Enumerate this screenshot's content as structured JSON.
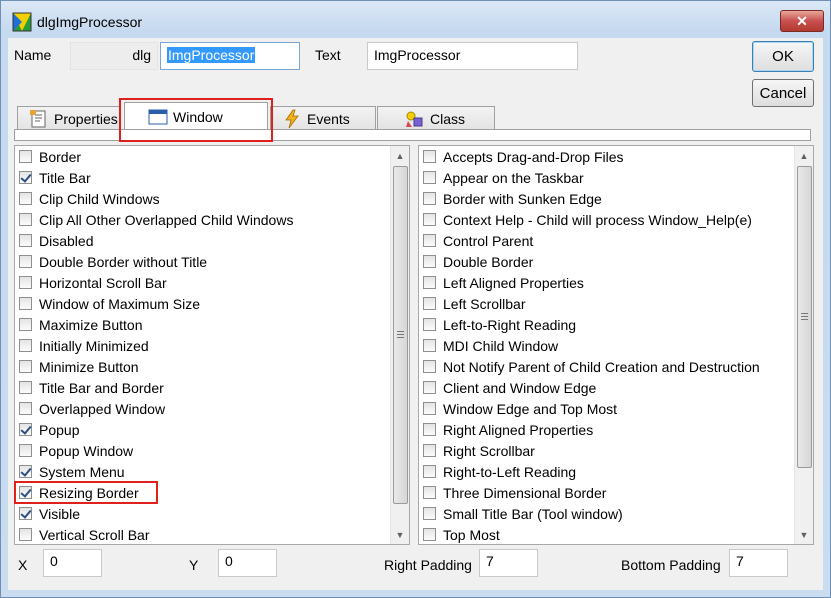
{
  "window": {
    "title": "dlgImgProcessor",
    "close_glyph": "✕"
  },
  "header": {
    "name_label": "Name",
    "name_prefix": "dlg",
    "name_value": "ImgProcessor",
    "text_label": "Text",
    "text_value": "ImgProcessor",
    "ok_label": "OK",
    "cancel_label": "Cancel"
  },
  "tabs": [
    {
      "label": "Properties",
      "icon": "properties-icon"
    },
    {
      "label": "Window",
      "icon": "window-icon",
      "active": true
    },
    {
      "label": "Events",
      "icon": "lightning-icon"
    },
    {
      "label": "Class",
      "icon": "class-icon"
    }
  ],
  "left_list": [
    {
      "label": "Border",
      "checked": false
    },
    {
      "label": "Title Bar",
      "checked": true
    },
    {
      "label": "Clip Child Windows",
      "checked": false
    },
    {
      "label": "Clip All Other Overlapped Child Windows",
      "checked": false
    },
    {
      "label": "Disabled",
      "checked": false
    },
    {
      "label": "Double Border without Title",
      "checked": false
    },
    {
      "label": "Horizontal Scroll Bar",
      "checked": false
    },
    {
      "label": "Window of Maximum Size",
      "checked": false
    },
    {
      "label": "Maximize Button",
      "checked": false
    },
    {
      "label": "Initially Minimized",
      "checked": false
    },
    {
      "label": "Minimize Button",
      "checked": false
    },
    {
      "label": "Title Bar and Border",
      "checked": false
    },
    {
      "label": "Overlapped Window",
      "checked": false
    },
    {
      "label": "Popup",
      "checked": true
    },
    {
      "label": "Popup Window",
      "checked": false
    },
    {
      "label": "System Menu",
      "checked": true
    },
    {
      "label": "Resizing Border",
      "checked": true
    },
    {
      "label": "Visible",
      "checked": true
    },
    {
      "label": "Vertical Scroll Bar",
      "checked": false
    }
  ],
  "right_list": [
    {
      "label": "Accepts Drag-and-Drop Files",
      "checked": false
    },
    {
      "label": "Appear on the Taskbar",
      "checked": false
    },
    {
      "label": "Border with Sunken Edge",
      "checked": false
    },
    {
      "label": "Context Help - Child will process Window_Help(e)",
      "checked": false
    },
    {
      "label": "Control Parent",
      "checked": false
    },
    {
      "label": "Double Border",
      "checked": false
    },
    {
      "label": "Left Aligned Properties",
      "checked": false
    },
    {
      "label": "Left Scrollbar",
      "checked": false
    },
    {
      "label": "Left-to-Right Reading",
      "checked": false
    },
    {
      "label": "MDI Child Window",
      "checked": false
    },
    {
      "label": "Not Notify Parent of Child Creation and Destruction",
      "checked": false
    },
    {
      "label": "Client and Window Edge",
      "checked": false
    },
    {
      "label": "Window Edge and Top Most",
      "checked": false
    },
    {
      "label": "Right Aligned Properties",
      "checked": false
    },
    {
      "label": "Right Scrollbar",
      "checked": false
    },
    {
      "label": "Right-to-Left Reading",
      "checked": false
    },
    {
      "label": "Three Dimensional Border",
      "checked": false
    },
    {
      "label": "Small Title Bar (Tool window)",
      "checked": false
    },
    {
      "label": "Top Most",
      "checked": false
    }
  ],
  "footer": {
    "x_label": "X",
    "x_value": "0",
    "y_label": "Y",
    "y_value": "0",
    "right_padding_label": "Right Padding",
    "right_padding_value": "7",
    "bottom_padding_label": "Bottom Padding",
    "bottom_padding_value": "7"
  },
  "colors": {
    "highlight": "#e0201b",
    "selection": "#3399ff",
    "close_button": "#c75050"
  }
}
